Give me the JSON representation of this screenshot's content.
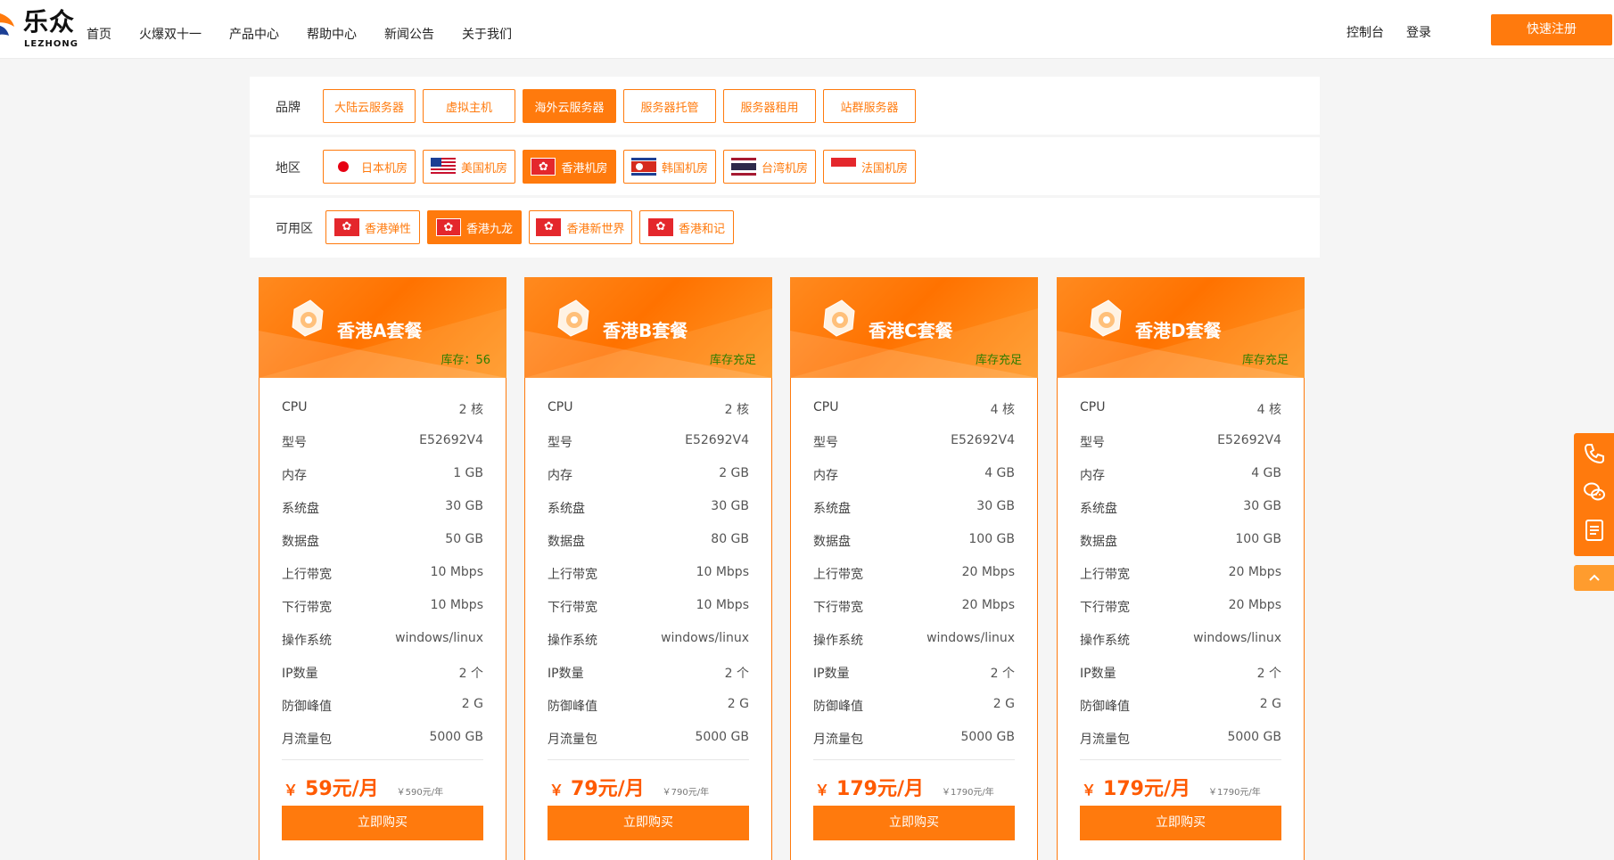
{
  "header": {
    "logo_cn": "乐众",
    "logo_en": "LEZHONG",
    "nav": [
      "首页",
      "火爆双十一",
      "产品中心",
      "帮助中心",
      "新闻公告",
      "关于我们"
    ],
    "console": "控制台",
    "login": "登录",
    "register": "快速注册"
  },
  "filter": {
    "brand_label": "品牌",
    "brands": [
      "大陆云服务器",
      "虚拟主机",
      "海外云服务器",
      "服务器托管",
      "服务器租用",
      "站群服务器"
    ],
    "region_label": "地区",
    "regions": [
      "日本机房",
      "美国机房",
      "香港机房",
      "韩国机房",
      "台湾机房",
      "法国机房"
    ],
    "zone_label": "可用区",
    "zones": [
      "香港弹性",
      "香港九龙",
      "香港新世界",
      "香港和记"
    ]
  },
  "spec_labels": [
    "CPU",
    "型号",
    "内存",
    "系统盘",
    "数据盘",
    "上行带宽",
    "下行带宽",
    "操作系统",
    "IP数量",
    "防御峰值",
    "月流量包"
  ],
  "cards": [
    {
      "name": "香港A套餐",
      "stock": "库存：56",
      "specs": [
        "2 核",
        "E52692V4",
        "1 GB",
        "30 GB",
        "50 GB",
        "10 Mbps",
        "10 Mbps",
        "windows/linux",
        "2 个",
        "2 G",
        "5000 GB"
      ],
      "yen": "￥",
      "month": "59元/月",
      "year": "￥590元/年",
      "buy": "立即购买"
    },
    {
      "name": "香港B套餐",
      "stock": "库存充足",
      "specs": [
        "2 核",
        "E52692V4",
        "2 GB",
        "30 GB",
        "80 GB",
        "10 Mbps",
        "10 Mbps",
        "windows/linux",
        "2 个",
        "2 G",
        "5000 GB"
      ],
      "yen": "￥",
      "month": "79元/月",
      "year": "￥790元/年",
      "buy": "立即购买"
    },
    {
      "name": "香港C套餐",
      "stock": "库存充足",
      "specs": [
        "4 核",
        "E52692V4",
        "4 GB",
        "30 GB",
        "100 GB",
        "20 Mbps",
        "20 Mbps",
        "windows/linux",
        "2 个",
        "2 G",
        "5000 GB"
      ],
      "yen": "￥",
      "month": "179元/月",
      "year": "￥1790元/年",
      "buy": "立即购买"
    },
    {
      "name": "香港D套餐",
      "stock": "库存充足",
      "specs": [
        "4 核",
        "E52692V4",
        "4 GB",
        "30 GB",
        "100 GB",
        "20 Mbps",
        "20 Mbps",
        "windows/linux",
        "2 个",
        "2 G",
        "5000 GB"
      ],
      "yen": "￥",
      "month": "179元/月",
      "year": "￥1790元/年",
      "buy": "立即购买"
    }
  ],
  "sidebar": {
    "icons": [
      "phone-icon",
      "wechat-icon",
      "document-icon"
    ],
    "totop_icon": "chevron-up-icon"
  },
  "colors": {
    "accent": "#ff7a0d",
    "stock_green": "#2e7d00"
  }
}
